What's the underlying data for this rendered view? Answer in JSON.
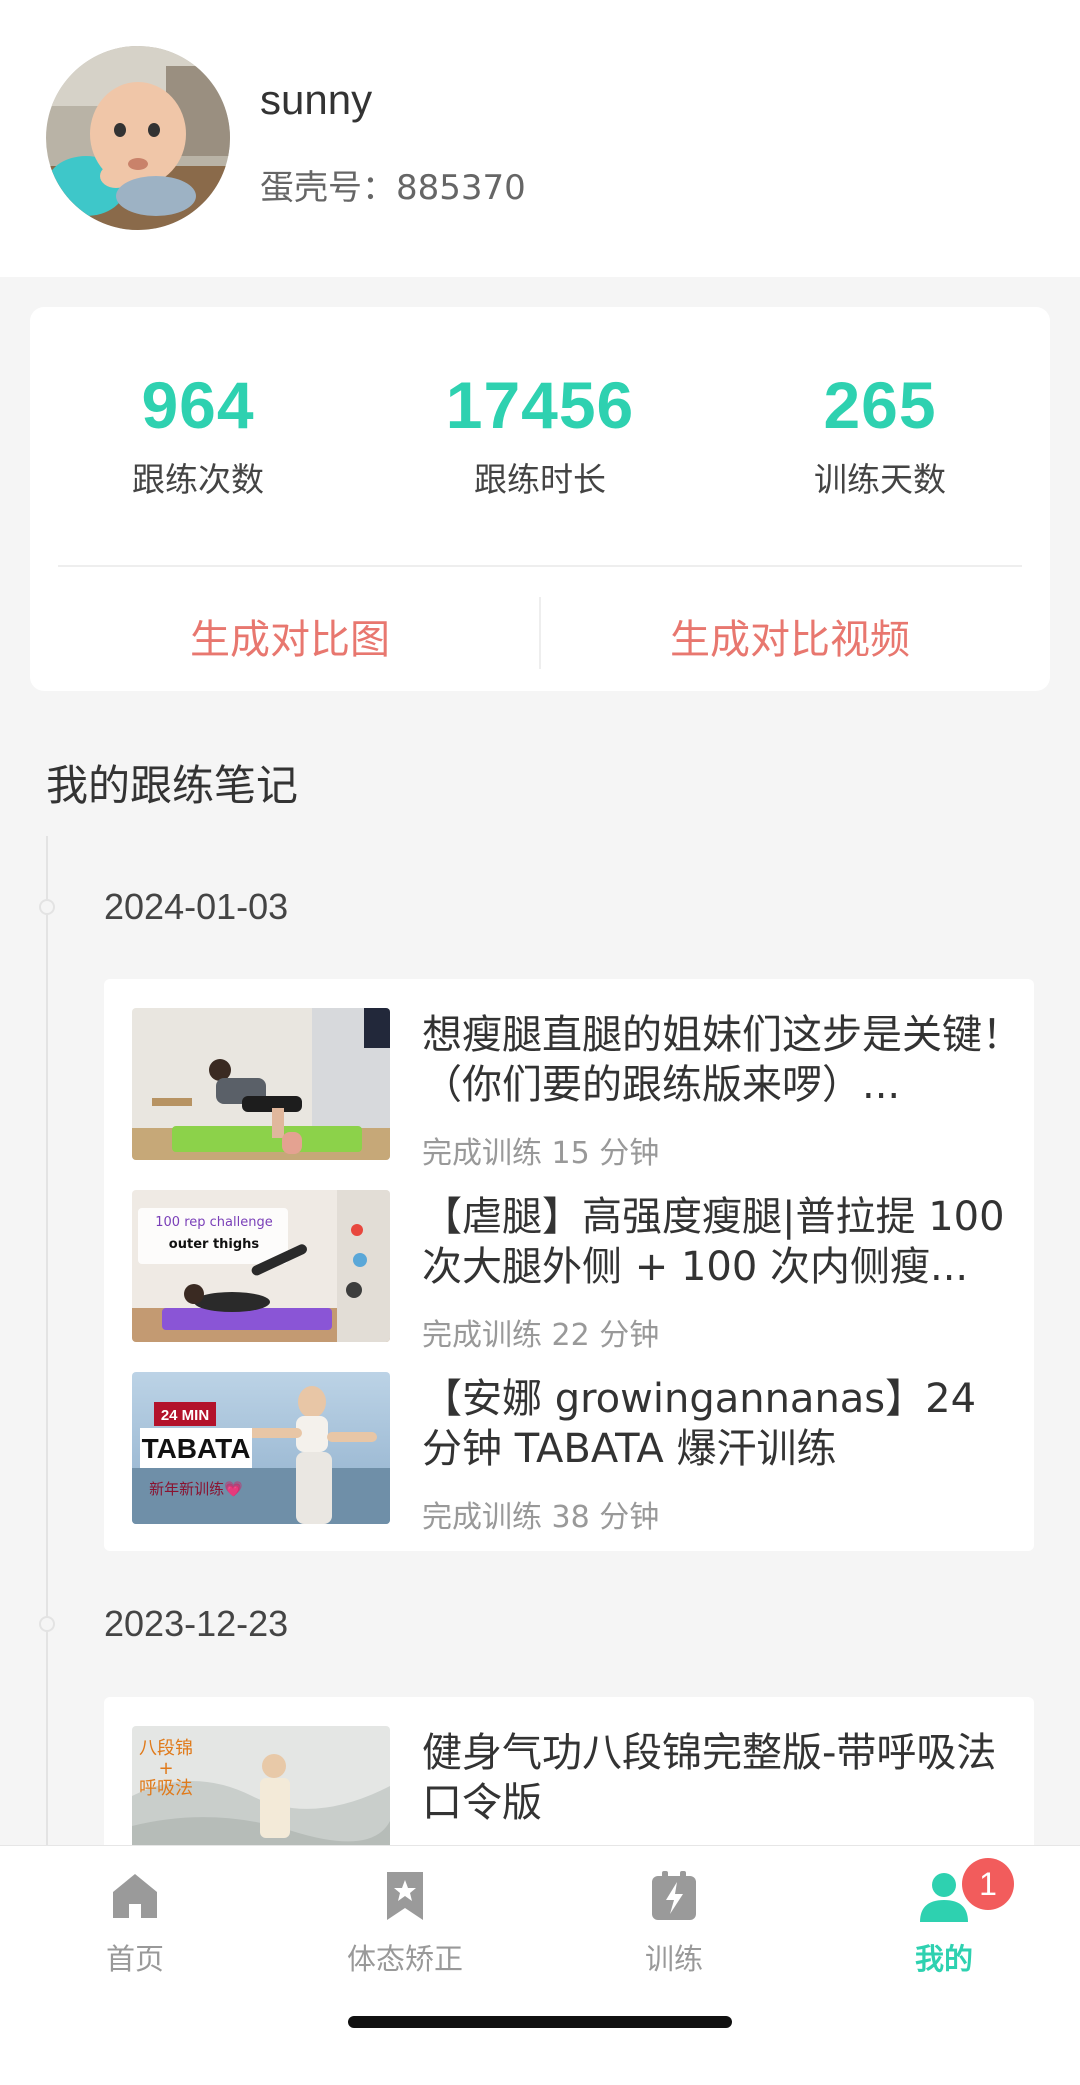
{
  "profile": {
    "username": "sunny",
    "uid": "蛋壳号：885370"
  },
  "stats": [
    {
      "value": "964",
      "label": "跟练次数"
    },
    {
      "value": "17456",
      "label": "跟练时长"
    },
    {
      "value": "265",
      "label": "训练天数"
    }
  ],
  "actions": {
    "compare_image": "生成对比图",
    "compare_video": "生成对比视频"
  },
  "notes": {
    "title": "我的跟练笔记",
    "groups": [
      {
        "date": "2024-01-03",
        "entries": [
          {
            "title": "想瘦腿直腿的姐妹们这步是关键！（你们要的跟练版来啰）...",
            "meta": "完成训练 15 分钟"
          },
          {
            "title": "【虐腿】高强度瘦腿|普拉提 100 次大腿外侧 + 100 次内侧瘦...",
            "meta": "完成训练 22 分钟",
            "thumb_text_1": "100 rep challenge",
            "thumb_text_2": "outer thighs"
          },
          {
            "title": "【安娜 growingannanas】24 分钟 TABATA 爆汗训练",
            "meta": "完成训练 38 分钟",
            "thumb_text_1": "24 MIN",
            "thumb_text_2": "TABATA",
            "thumb_text_3": "新年新训练💗"
          }
        ]
      },
      {
        "date": "2023-12-23",
        "entries": [
          {
            "title": "健身气功八段锦完整版-带呼吸法口令版",
            "meta": "",
            "thumb_text_1": "八段锦",
            "thumb_text_2": "+",
            "thumb_text_3": "呼吸法"
          }
        ]
      }
    ]
  },
  "nav": {
    "items": [
      {
        "label": "首页",
        "icon": "home-icon"
      },
      {
        "label": "体态矫正",
        "icon": "bookmark-star-icon"
      },
      {
        "label": "训练",
        "icon": "lightning-icon"
      },
      {
        "label": "我的",
        "icon": "user-icon",
        "badge": "1"
      }
    ]
  },
  "colors": {
    "accent": "#2ed1b0",
    "action": "#e8776f",
    "badge": "#f25c5c"
  }
}
